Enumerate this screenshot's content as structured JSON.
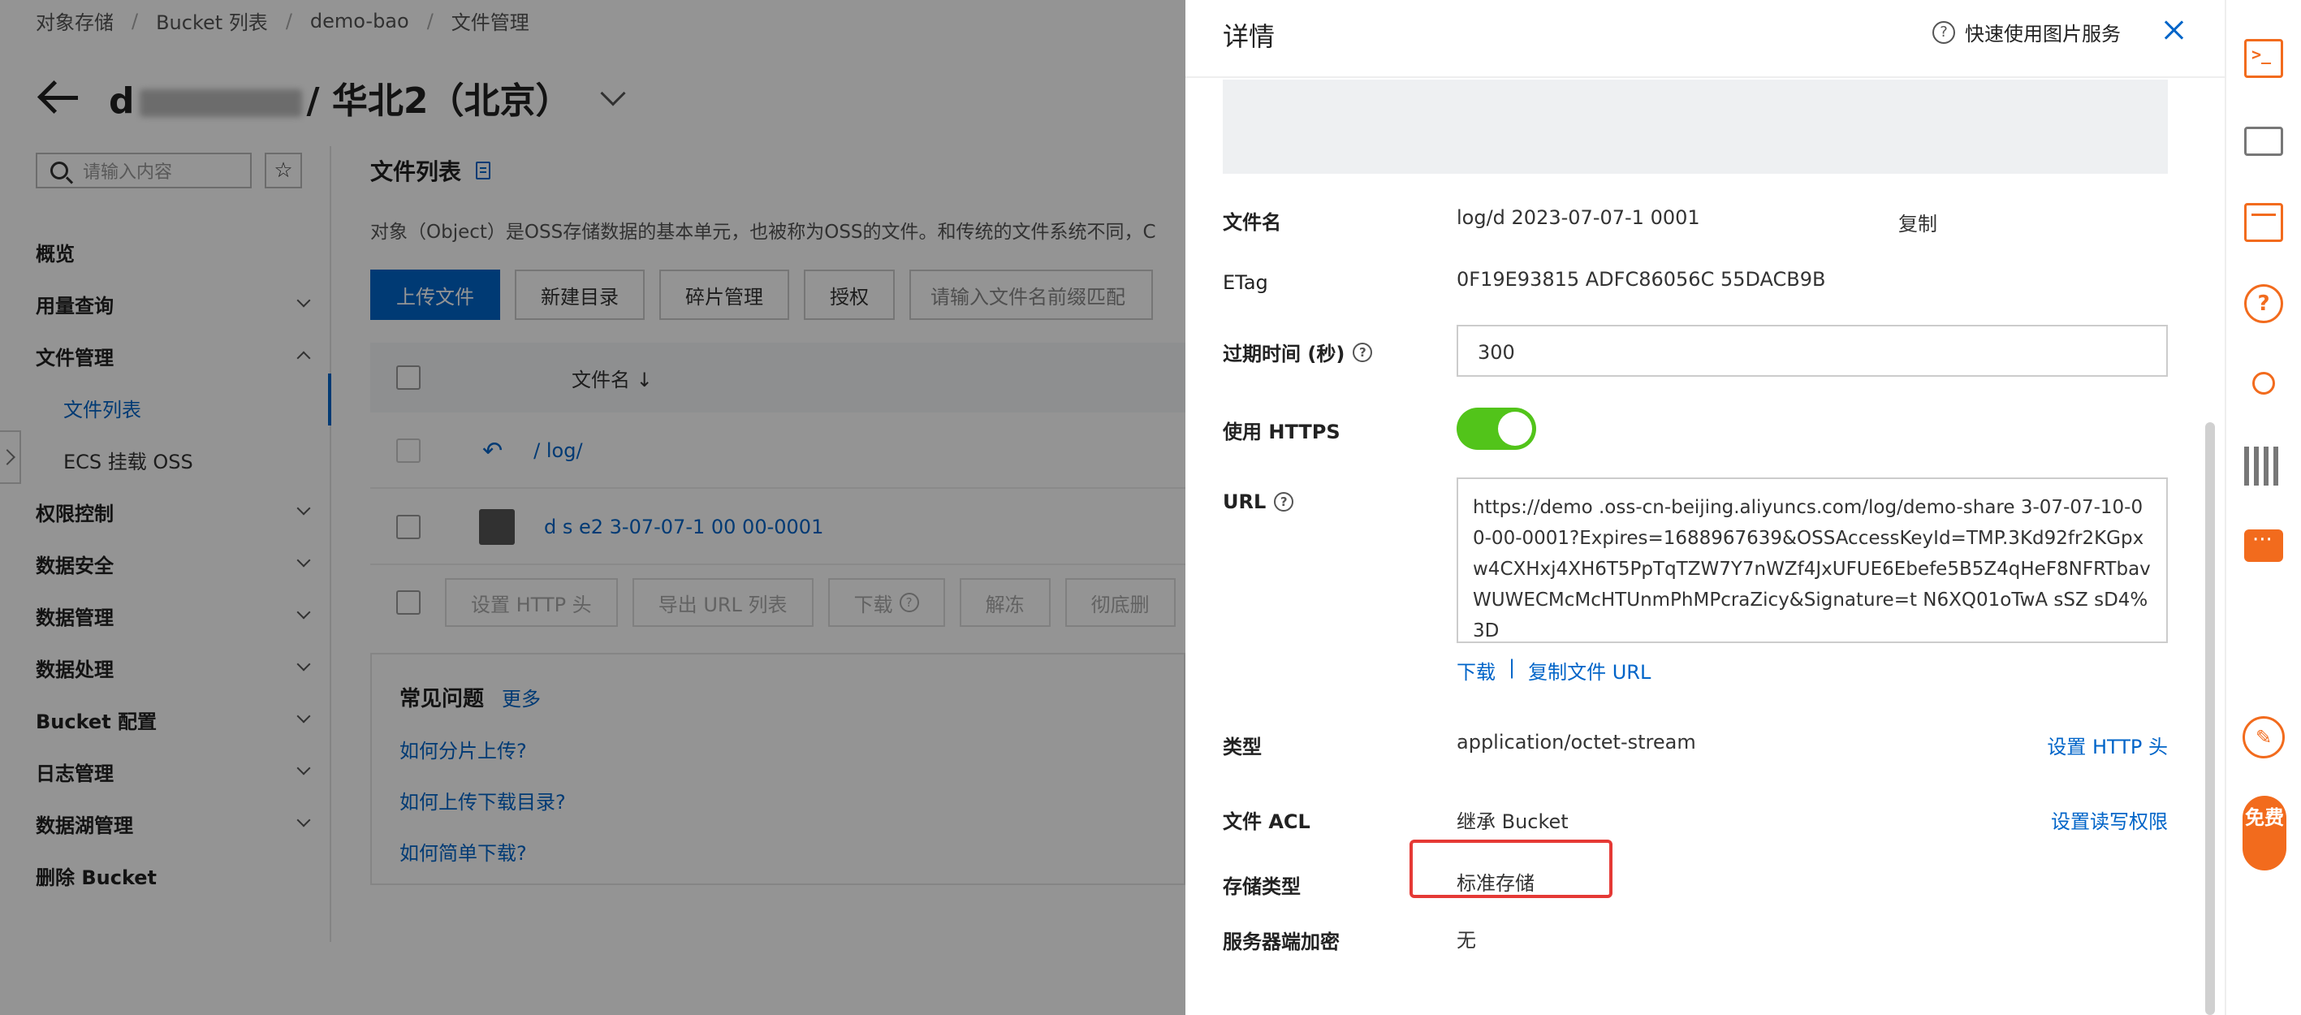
{
  "breadcrumb": [
    "对象存储",
    "Bucket 列表",
    "demo-bao",
    "文件管理"
  ],
  "header": {
    "bucket_prefix": "d",
    "region_suffix": "/ 华北2（北京）"
  },
  "sidebar": {
    "search_placeholder": "请输入内容",
    "items": [
      {
        "label": "概览",
        "chevron": false
      },
      {
        "label": "用量查询",
        "chevron": true
      },
      {
        "label": "文件管理",
        "chevron": true
      },
      {
        "label": "文件列表",
        "sub": true
      },
      {
        "label": "ECS 挂载 OSS",
        "sub": true
      },
      {
        "label": "权限控制",
        "chevron": true
      },
      {
        "label": "数据安全",
        "chevron": true
      },
      {
        "label": "数据管理",
        "chevron": true
      },
      {
        "label": "数据处理",
        "chevron": true
      },
      {
        "label": "Bucket 配置",
        "chevron": true
      },
      {
        "label": "日志管理",
        "chevron": true
      },
      {
        "label": "数据湖管理",
        "chevron": true
      },
      {
        "label": "删除 Bucket",
        "chevron": false
      }
    ]
  },
  "main": {
    "section_title": "文件列表",
    "description": "对象（Object）是OSS存储数据的基本单元，也被称为OSS的文件。和传统的文件系统不同，C",
    "toolbar": {
      "upload": "上传文件",
      "new_dir": "新建目录",
      "fragments": "碎片管理",
      "authorize": "授权",
      "prefix_placeholder": "请输入文件名前缀匹配"
    },
    "table": {
      "col_name": "文件名",
      "sort_glyph": "↓",
      "row_parent": "/ log/",
      "row_file": "d   s   e2   3-07-07-1   00   00-0001"
    },
    "bulk": [
      "设置 HTTP 头",
      "导出 URL 列表",
      "下载",
      "解冻",
      "彻底删"
    ],
    "faq": {
      "title": "常见问题",
      "more": "更多",
      "items": [
        "如何分片上传?",
        "如何上传下载目录?",
        "如何简单下载?"
      ]
    }
  },
  "drawer": {
    "title": "详情",
    "help_link": "快速使用图片服务",
    "filename_label": "文件名",
    "filename_value": "log/d          2023-07-07-1         0001",
    "copy_link": "复制",
    "etag_label": "ETag",
    "etag_value": "0F19E93815  ADFC86056C  55DACB9B",
    "expire_label": "过期时间 (秒)",
    "expire_value": "300",
    "https_label": "使用 HTTPS",
    "https_on": true,
    "url_label": "URL",
    "url_value": "https://demo    .oss-cn-beijing.aliyuncs.com/log/demo-share    3-07-07-10-00-00-0001?Expires=1688967639&OSSAccessKeyId=TMP.3Kd92fr2KGpxw4CXHxj4XH6T5PpTqTZW7Y7nWZf4JxUFUE6Ebefe5B5Z4qHeF8NFRTbavWUWECMcMcHTUnmPhMPcraZicy&Signature=t     N6XQ01oTwA   sSZ   sD4%3D",
    "download_link": "下载",
    "link_sep": "|",
    "copy_url_link": "复制文件 URL",
    "type_label": "类型",
    "type_value": "application/octet-stream",
    "set_http_header": "设置 HTTP 头",
    "acl_label": "文件 ACL",
    "acl_value": "继承 Bucket",
    "set_acl": "设置读写权限",
    "storage_label": "存储类型",
    "storage_value": "标准存储",
    "encrypt_label": "服务器端加密",
    "encrypt_value": "无"
  },
  "rail": {
    "free_label": "免费"
  },
  "colors": {
    "primary": "#0064c8",
    "toggle_on": "#52c41a",
    "rail_accent": "#f26b1d",
    "highlight": "#e53935"
  }
}
